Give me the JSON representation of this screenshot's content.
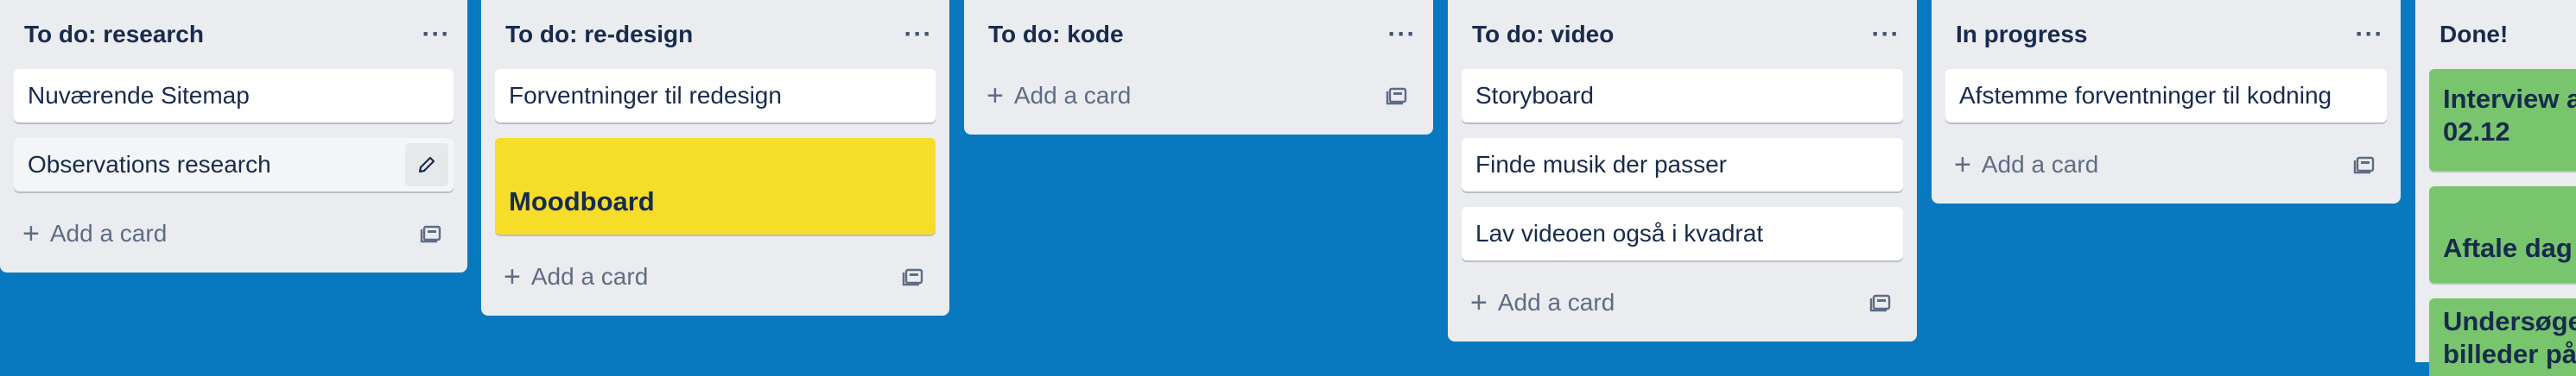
{
  "lists": [
    {
      "title": "To do: research",
      "cards": [
        "Nuværende Sitemap",
        "Observations research"
      ],
      "add_label": "Add a card"
    },
    {
      "title": "To do: re-design",
      "cards": [
        "Forventninger til redesign",
        "Moodboard"
      ],
      "add_label": "Add a card"
    },
    {
      "title": "To do: kode",
      "cards": [],
      "add_label": "Add a card"
    },
    {
      "title": "To do: video",
      "cards": [
        "Storyboard",
        "Finde musik der passer",
        "Lav videoen også i kvadrat"
      ],
      "add_label": "Add a card"
    },
    {
      "title": "In progress",
      "cards": [
        "Afstemme forventninger til kodning"
      ],
      "add_label": "Add a card"
    },
    {
      "title": "Done!",
      "cards": [
        "Interview a",
        "02.12",
        "Aftale dag",
        "Undersøge",
        "billeder på"
      ]
    }
  ],
  "colors": {
    "board_background": "#0979bf",
    "list_background": "#ebecf0",
    "yellow_label": "#f5dd29",
    "green_label": "#79c56e"
  },
  "icons": {
    "menu": "more-horizontal-icon",
    "add": "plus-icon",
    "template": "card-template-icon",
    "edit": "pencil-icon"
  }
}
